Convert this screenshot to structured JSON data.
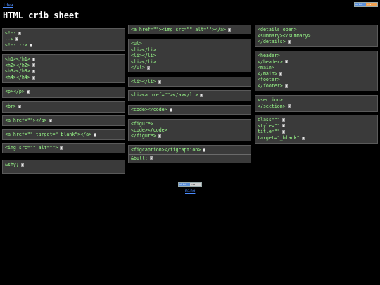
{
  "header": {
    "top_link": "idea",
    "title": "HTML crib sheet",
    "badge_left": "xhtml",
    "badge_right": "css",
    "center_badge_left": "xhtml",
    "center_badge_right": "css"
  },
  "footer": {
    "link": "mine"
  },
  "column1": [
    {
      "lines": [
        "<!--",
        "-->",
        "<!-- -->"
      ]
    },
    {
      "lines": [
        "<h1></h1>",
        "<h2></h2>",
        "<h3></h3>",
        "<h4></h4>"
      ]
    },
    {
      "lines": [
        "<p></p>"
      ]
    },
    {
      "lines": [
        "<br>"
      ]
    },
    {
      "lines": [
        "<a href=\"\"></a>"
      ]
    },
    {
      "lines": [
        "<a href=\"\" target=\"_blank\"></a>"
      ]
    },
    {
      "lines": [
        "<img src=\"\" alt=\"\">"
      ]
    },
    {
      "lines": [
        "&shy;"
      ]
    }
  ],
  "column2": [
    {
      "lines": [
        "<a href=\"\"><img src=\"\" alt=\"\"></a>"
      ]
    },
    {
      "lines": [
        "<ul>",
        "<li></li>",
        "<li></li>",
        "<li></li>",
        "</ul>"
      ]
    },
    {
      "lines": [
        "<li></li>"
      ]
    },
    {
      "lines": [
        "<li><a href=\"\"></a></li>"
      ]
    },
    {
      "lines": [
        "<code></code>"
      ]
    },
    {
      "lines": [
        "<figure>",
        "<code></code>",
        "</figure>"
      ]
    },
    {
      "lines": [
        "<figcaption></figcaption>",
        "&bull;"
      ]
    }
  ],
  "column3": [
    {
      "lines": [
        "<details open>",
        "<summary></summary>",
        "</details>"
      ]
    },
    {
      "lines": [
        "<header>",
        "</header>",
        "<main>",
        "</main>",
        "<footer>",
        "</footer>"
      ]
    },
    {
      "lines": [
        "<section>",
        "</section>"
      ]
    },
    {
      "lines": [
        "class=\"\"",
        "style=\"\"",
        "title=\"\"",
        "target=\"_blank\""
      ]
    }
  ]
}
